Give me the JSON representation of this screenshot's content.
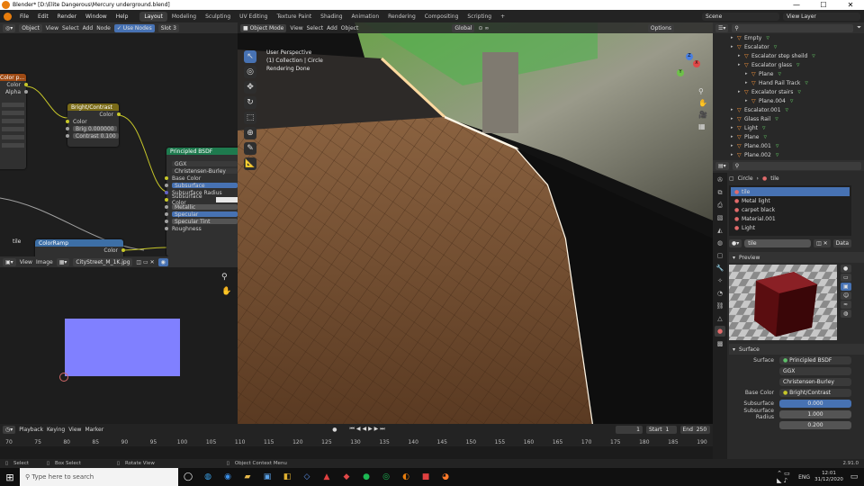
{
  "window": {
    "title": "Blender* [D:\\Elite Dangerous\\Mercury underground.blend]",
    "minimize": "—",
    "maximize": "☐",
    "close": "✕"
  },
  "menu": [
    "File",
    "Edit",
    "Render",
    "Window",
    "Help"
  ],
  "workspaces": [
    "Layout",
    "Modeling",
    "Sculpting",
    "UV Editing",
    "Texture Paint",
    "Shading",
    "Animation",
    "Rendering",
    "Compositing",
    "Scripting"
  ],
  "active_workspace": "Layout",
  "add_workspace": "+",
  "scene": "Scene",
  "view_layer": "View Layer",
  "node_editor": {
    "header": {
      "mode": "Object",
      "menus": [
        "View",
        "Select",
        "Add",
        "Node"
      ],
      "use_nodes": "Use Nodes",
      "slot": "Slot 3"
    },
    "color_node": {
      "title": "Color p...",
      "outputs": [
        "Color",
        "Alpha"
      ]
    },
    "bright_contrast": {
      "title": "Bright/Contrast",
      "output": "Color",
      "input": "Color",
      "bright_label": "Brig",
      "bright_value": "0.000000",
      "contrast_label": "Contrast",
      "contrast_value": "0.100"
    },
    "principled": {
      "title": "Principled BSDF",
      "distribution": "GGX",
      "subsurface_method": "Christensen-Burley",
      "rows": [
        "Base Color",
        "Subsurface",
        "Subsurface Radius",
        "Subsurface Color",
        "Metallic",
        "Specular",
        "Specular Tint",
        "Roughness"
      ]
    },
    "color_ramp": {
      "title": "ColorRamp",
      "output": "Color"
    },
    "tile_label": "tile"
  },
  "image_editor": {
    "menus": [
      "View",
      "Image"
    ],
    "image_name": "CityStreet_M_1K.jpg"
  },
  "viewport": {
    "header": {
      "mode": "Object Mode",
      "menus": [
        "View",
        "Select",
        "Add",
        "Object"
      ],
      "orientation": "Global",
      "options": "Options"
    },
    "overlay_text": [
      "User Perspective",
      "(1) Collection | Circle",
      "Rendering Done"
    ],
    "gizmo_axes": [
      "X",
      "Y",
      "Z"
    ]
  },
  "outliner": {
    "items": [
      {
        "label": "Empty",
        "depth": 2
      },
      {
        "label": "Escalator",
        "depth": 2
      },
      {
        "label": "Escalator step sheild",
        "depth": 3
      },
      {
        "label": "Escalator glass",
        "depth": 3
      },
      {
        "label": "Plane",
        "depth": 4
      },
      {
        "label": "Hand Rail Track",
        "depth": 4
      },
      {
        "label": "Excalator stairs",
        "depth": 3
      },
      {
        "label": "Plane.004",
        "depth": 4
      },
      {
        "label": "Escalator.001",
        "depth": 2
      },
      {
        "label": "Glass Rail",
        "depth": 2
      },
      {
        "label": "Light",
        "depth": 2
      },
      {
        "label": "Plane",
        "depth": 2
      },
      {
        "label": "Plane.001",
        "depth": 2
      },
      {
        "label": "Plane.002",
        "depth": 2
      },
      {
        "label": "rail track",
        "depth": 2
      }
    ]
  },
  "properties": {
    "breadcrumb_object": "Circle",
    "breadcrumb_material": "tile",
    "material_slots": [
      "tile",
      "Metal light",
      "carpet black",
      "Material.001",
      "Light"
    ],
    "active_material": "tile",
    "link": "Data",
    "preview_label": "Preview",
    "surface_label": "Surface",
    "surface_shader_label": "Surface",
    "surface_shader": "Principled BSDF",
    "distribution": "GGX",
    "subsurface_method": "Christensen-Burley",
    "base_color_label": "Base Color",
    "base_color_value": "Bright/Contrast",
    "subsurface_label": "Subsurface",
    "subsurface_value": "0.000",
    "subsurface_radius_label": "Subsurface Radius",
    "subsurface_radius_values": [
      "1.000",
      "0.200"
    ]
  },
  "timeline": {
    "menus": [
      "Playback",
      "Keying",
      "View",
      "Marker"
    ],
    "current_frame": "1",
    "start_label": "Start",
    "start": "1",
    "end_label": "End",
    "end": "250",
    "ticks": [
      "70",
      "75",
      "80",
      "85",
      "90",
      "95",
      "100",
      "105",
      "110",
      "115",
      "120",
      "125",
      "130",
      "135",
      "140",
      "145",
      "150",
      "155",
      "160",
      "165",
      "170",
      "175",
      "180",
      "185",
      "190"
    ]
  },
  "statusbar": {
    "items": [
      "Select",
      "Box Select",
      "Rotate View",
      "Object Context Menu"
    ],
    "version": "2.91.0"
  },
  "taskbar": {
    "search_placeholder": "Type here to search",
    "time": "12:01",
    "date": "31/12/2020",
    "lang": "ENG"
  }
}
